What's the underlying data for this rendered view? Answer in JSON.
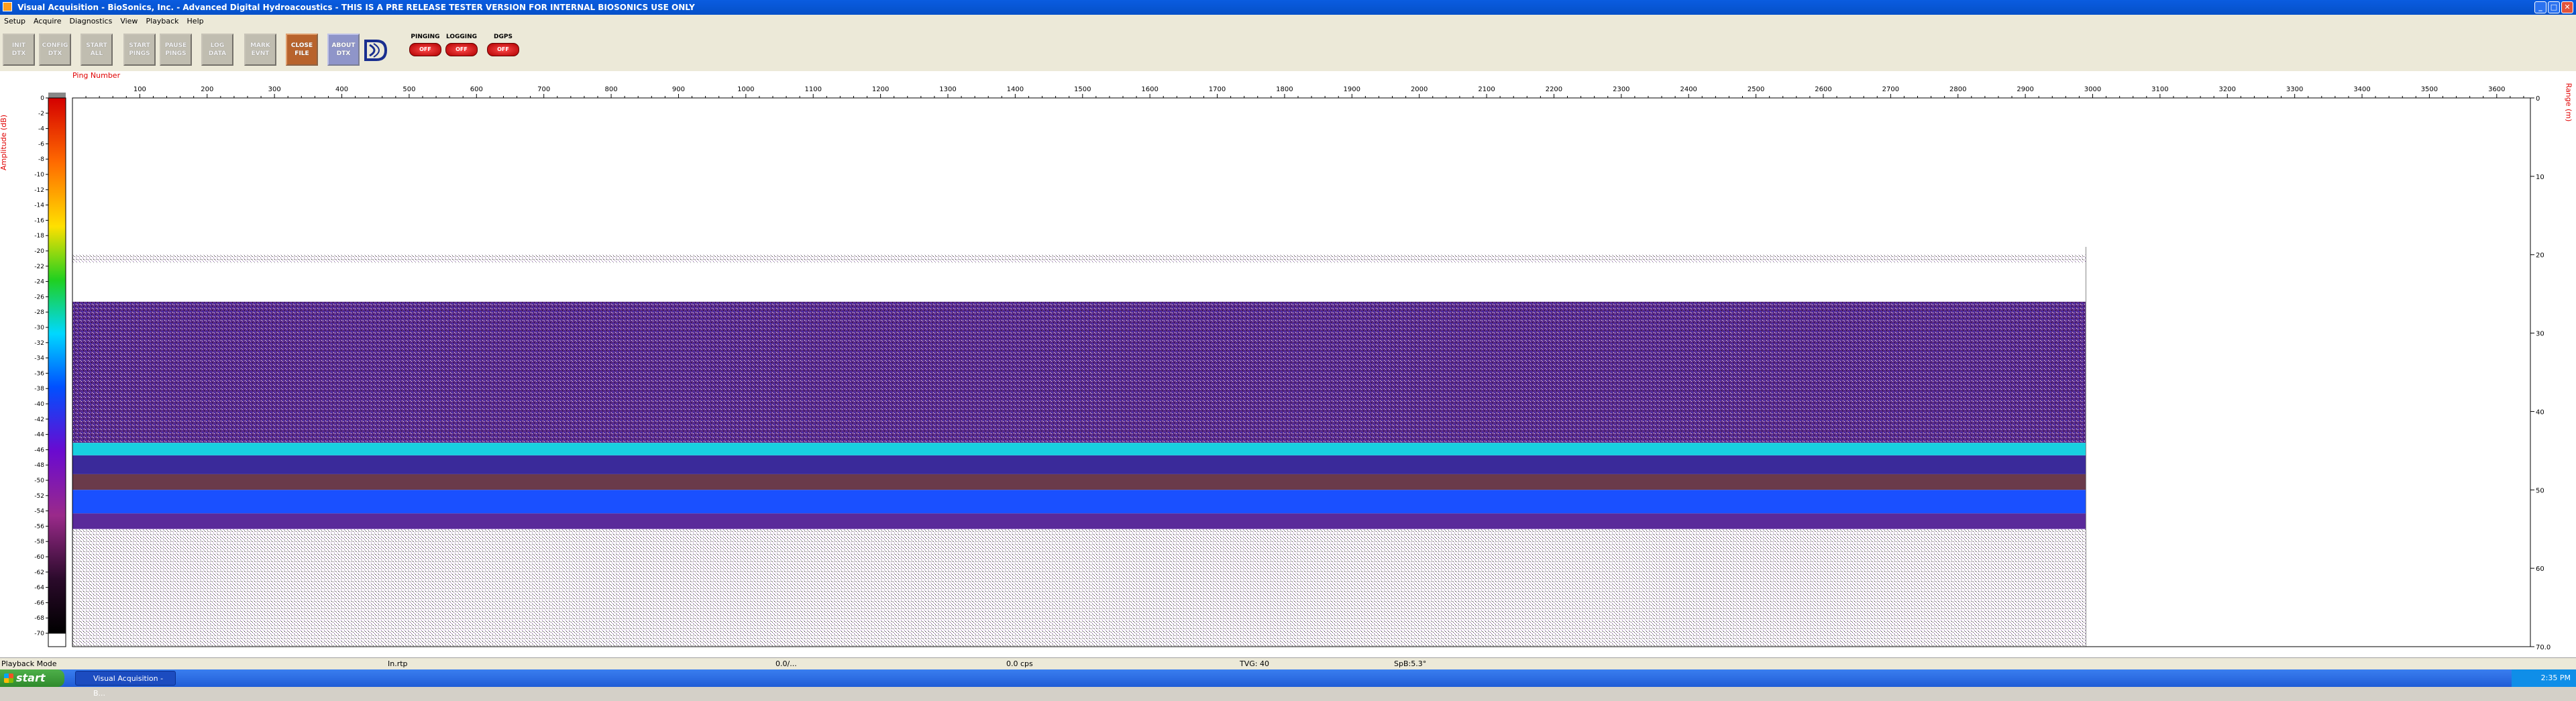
{
  "window": {
    "title": "Visual Acquisition  -  BioSonics, Inc.  -  Advanced Digital Hydroacoustics  -  THIS IS A PRE RELEASE TESTER VERSION FOR INTERNAL BIOSONICS USE ONLY",
    "controls": [
      "_",
      "□",
      "✕"
    ]
  },
  "menu": [
    "Setup",
    "Acquire",
    "Diagnostics",
    "View",
    "Playback",
    "Help"
  ],
  "toolbar": {
    "buttons": [
      "INIT\nDTX",
      "CONFIG\nDTX",
      "START\nALL",
      "START\nPINGS",
      "PAUSE\nPINGS",
      "LOG\nDATA",
      "MARK\nEVNT",
      "CLOSE\nFILE",
      "ABOUT\nDTX"
    ],
    "status": [
      {
        "label": "PINGING",
        "value": "OFF"
      },
      {
        "label": "LOGGING",
        "value": "OFF"
      },
      {
        "label": "DGPS",
        "value": "OFF"
      }
    ],
    "logo_icon": "biosonics-logo-icon"
  },
  "echogram": {
    "top_axis_title": "Ping Number",
    "x_ticks": [
      "100",
      "200",
      "300",
      "400",
      "500",
      "600",
      "700",
      "800",
      "900",
      "1000",
      "1100",
      "1200",
      "1300",
      "1400",
      "1500",
      "1600",
      "1700",
      "1800",
      "1900",
      "2000",
      "2100",
      "2200",
      "2300",
      "2400",
      "2500",
      "2600",
      "2700",
      "2800",
      "2900",
      "3000",
      "3100",
      "3200",
      "3300",
      "3400",
      "3500",
      "3600"
    ],
    "x_max": 3650,
    "data_end_ping": 2990,
    "left_axis_title": "Amplitude (dB)",
    "colorbar_ticks": [
      "0",
      "-2",
      "-4",
      "-6",
      "-8",
      "-10",
      "-12",
      "-14",
      "-16",
      "-18",
      "-20",
      "-22",
      "-24",
      "-26",
      "-28",
      "-30",
      "-32",
      "-34",
      "-36",
      "-38",
      "-40",
      "-42",
      "-44",
      "-46",
      "-48",
      "-50",
      "-52",
      "-54",
      "-56",
      "-58",
      "-60",
      "-62",
      "-64",
      "-66",
      "-68",
      "-70"
    ],
    "right_axis_title": "Range (m)",
    "range_ticks": [
      "0",
      "10",
      "20",
      "30",
      "40",
      "50",
      "60",
      "70.0"
    ],
    "range_max": 70,
    "colors": {
      "axis_title": "#e00000",
      "colorbar_top": "#d40000",
      "colorbar_bottom": "#000000"
    }
  },
  "statusbar": {
    "mode": "Playback Mode",
    "f1": "In.rtp",
    "f2": "0.0/...",
    "f3": "0.0 cps",
    "f4": "TVG: 40",
    "f5": "SpB:5.3°"
  },
  "taskbar": {
    "start": "start",
    "item": "Visual Acquisition  -  B...",
    "clock": "2:35 PM"
  }
}
